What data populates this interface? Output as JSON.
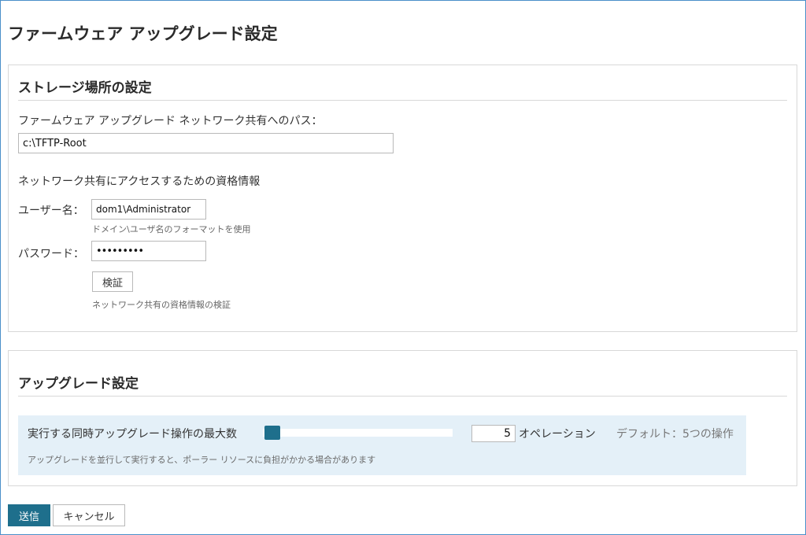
{
  "page": {
    "title": "ファームウェア アップグレード設定"
  },
  "storage": {
    "section_title": "ストレージ場所の設定",
    "path_label": "ファームウェア アップグレード ネットワーク共有へのパス：",
    "path_value": "c:\\TFTP-Root",
    "credentials_heading": "ネットワーク共有にアクセスするための資格情報",
    "username_label": "ユーザー名：",
    "username_value": "dom1\\Administrator",
    "username_hint": "ドメイン\\ユーザ名のフォーマットを使用",
    "password_label": "パスワード：",
    "password_value": "•••••••••",
    "verify_button": "検証",
    "verify_hint": "ネットワーク共有の資格情報の検証"
  },
  "upgrade": {
    "section_title": "アップグレード設定",
    "concurrency_label": "実行する同時アップグレード操作の最大数",
    "concurrency_value": "5",
    "slider_fraction": 0.05,
    "unit_label": "オペレーション",
    "default_text": "デフォルト：5つの操作",
    "warning_text": "アップグレードを並行して実行すると、ポーラー リソースに負担がかかる場合があります"
  },
  "footer": {
    "submit_button": "送信",
    "cancel_button": "キャンセル"
  },
  "colors": {
    "accent": "#1e6f8c",
    "panel_highlight": "#e4f0f8",
    "border": "#d8d8d8",
    "window_border": "#4a8fc9"
  }
}
